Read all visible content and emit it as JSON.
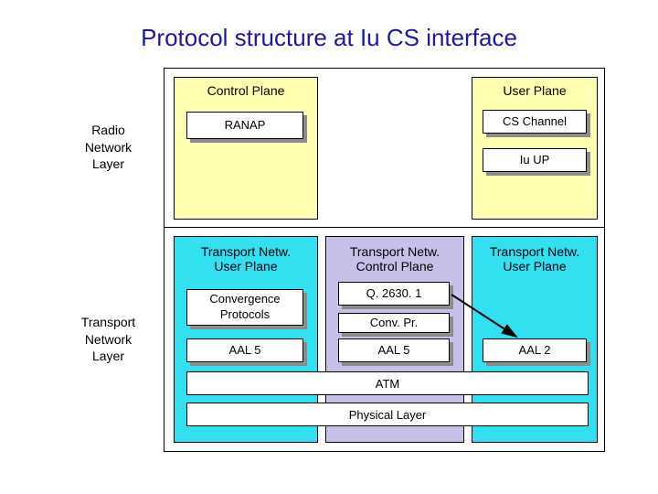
{
  "title": "Protocol structure at Iu CS interface",
  "left_labels": {
    "rnl": "Radio\nNetwork\nLayer",
    "tnl": "Transport\nNetwork\nLayer"
  },
  "rnl": {
    "control_plane": {
      "heading": "Control Plane",
      "box": "RANAP"
    },
    "user_plane": {
      "heading": "User Plane",
      "box1": "CS Channel",
      "box2": "Iu UP"
    }
  },
  "tnl": {
    "col_a": {
      "heading": "Transport Netw.\nUser Plane",
      "box1": "Convergence\nProtocols",
      "box2": "AAL 5"
    },
    "col_b": {
      "heading": "Transport Netw.\nControl Plane",
      "box1": "Q. 2630. 1",
      "box2": "Conv. Pr.",
      "box3": "AAL 5"
    },
    "col_c": {
      "heading": "Transport Netw.\nUser Plane",
      "box1": "AAL 2"
    },
    "atm": "ATM",
    "phys": "Physical Layer"
  }
}
